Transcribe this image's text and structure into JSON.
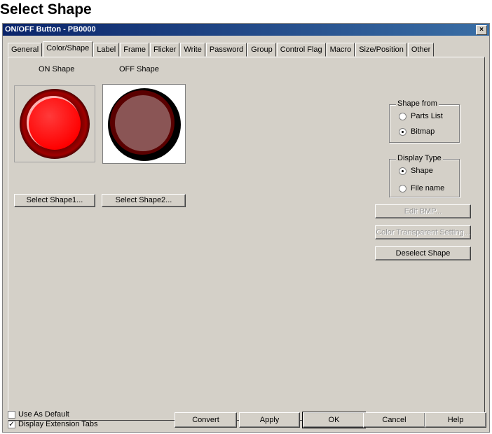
{
  "heading": "Select Shape",
  "window": {
    "title": "ON/OFF Button - PB0000",
    "close_glyph": "×"
  },
  "tabs": [
    {
      "label": "General"
    },
    {
      "label": "Color/Shape"
    },
    {
      "label": "Label"
    },
    {
      "label": "Frame"
    },
    {
      "label": "Flicker"
    },
    {
      "label": "Write"
    },
    {
      "label": "Password"
    },
    {
      "label": "Group"
    },
    {
      "label": "Control Flag"
    },
    {
      "label": "Macro"
    },
    {
      "label": "Size/Position"
    },
    {
      "label": "Other"
    }
  ],
  "active_tab": "Color/Shape",
  "shapes": {
    "on_label": "ON Shape",
    "off_label": "OFF Shape",
    "select1": "Select Shape1...",
    "select2": "Select Shape2..."
  },
  "shape_from": {
    "title": "Shape from",
    "options": [
      {
        "label": "Parts List",
        "checked": false
      },
      {
        "label": "Bitmap",
        "checked": true
      }
    ]
  },
  "display_type": {
    "title": "Display Type",
    "options": [
      {
        "label": "Shape",
        "checked": true
      },
      {
        "label": "File name",
        "checked": false
      }
    ]
  },
  "side_buttons": {
    "edit_bmp": "Edit BMP...",
    "color_transparent": "Color Transparent Setting...",
    "deselect": "Deselect Shape"
  },
  "footer": {
    "use_as_default": "Use As Default",
    "use_as_default_checked": false,
    "display_ext_tabs": "Display Extension Tabs",
    "display_ext_tabs_checked": true,
    "convert": "Convert",
    "apply": "Apply",
    "ok": "OK",
    "cancel": "Cancel",
    "help": "Help"
  },
  "colors": {
    "title_bar_start": "#0a246a",
    "dialog_face": "#d4d0c8",
    "on_red": "#ff1a1a",
    "off_pink": "#8a5555"
  }
}
